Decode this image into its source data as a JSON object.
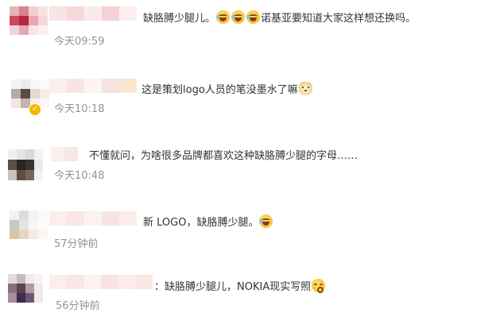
{
  "comments": [
    {
      "text_before": "缺胳膊少腿儿。",
      "text_after": "诺基亚要知道大家这样想还换吗。",
      "time": "今天09:59",
      "emojis": [
        "laugh-cry-emoji",
        "laugh-cry-emoji",
        "laugh-cry-emoji"
      ]
    },
    {
      "text_before": "这是策划logo人员的笔没墨水了嘛",
      "text_after": "",
      "time": "今天10:18",
      "emojis": [
        "dog-emoji"
      ],
      "verified_badge": "✓"
    },
    {
      "text_before": "不懂就问，为啥很多品牌都喜欢这种缺胳膊少腿的字母……",
      "text_after": "",
      "time": "今天10:48",
      "emojis": []
    },
    {
      "text_before": "新 LOGO，缺胳膊少腿。",
      "text_after": "",
      "time": "57分钟前",
      "emojis": [
        "laugh-cry-emoji"
      ]
    },
    {
      "text_before": "：缺胳膊少腿儿，NOKIA现实写照",
      "text_after": "",
      "time": "56分钟前",
      "emojis": [
        "blush-emoji"
      ]
    }
  ]
}
